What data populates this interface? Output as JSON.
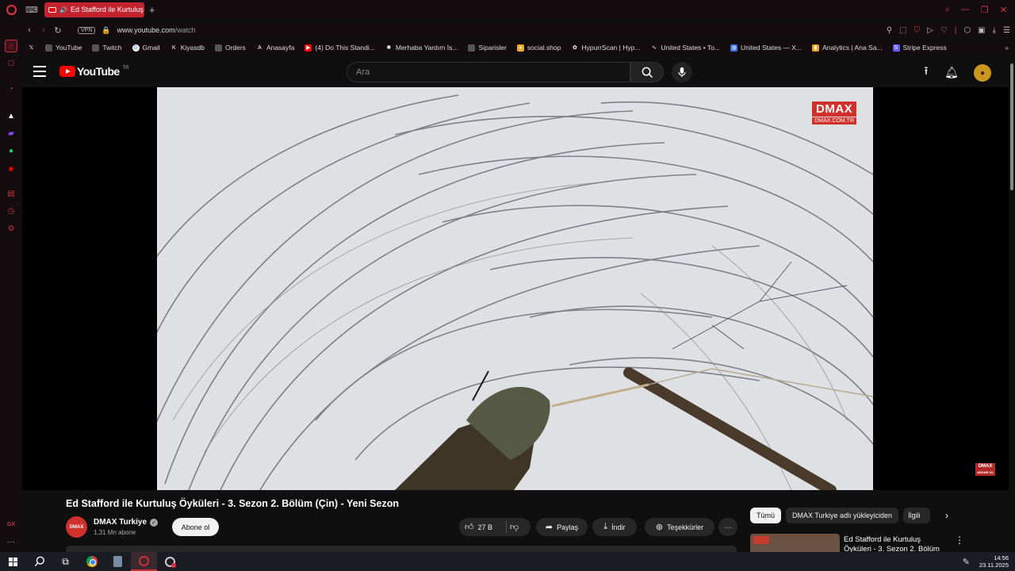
{
  "browser": {
    "tab_title": "Ed Stafford ile Kurtuluş",
    "url_domain": "www.youtube.com",
    "url_path": "/watch",
    "vpn_label": "VPN",
    "bookmarks": [
      {
        "label": "",
        "icon": "x-icon"
      },
      {
        "label": "YouTube",
        "icon": "page-icon"
      },
      {
        "label": "Twitch",
        "icon": "page-icon"
      },
      {
        "label": "Gmail",
        "icon": "google-icon"
      },
      {
        "label": "Kiyasdb",
        "icon": "k-icon"
      },
      {
        "label": "Orders",
        "icon": "page-icon"
      },
      {
        "label": "Anasayfa",
        "icon": "a-icon"
      },
      {
        "label": "(4) Do This Standi...",
        "icon": "youtube-icon"
      },
      {
        "label": "Merhaba Yardım İs...",
        "icon": "openai-icon"
      },
      {
        "label": "Siparisler",
        "icon": "page-icon"
      },
      {
        "label": "social.shop",
        "icon": "social-icon"
      },
      {
        "label": "HypurrScan | Hyp...",
        "icon": "hypurr-icon"
      },
      {
        "label": "United States • To...",
        "icon": "chart-icon"
      },
      {
        "label": "United States — X...",
        "icon": "globe-icon"
      },
      {
        "label": "Analytics | Ana Sa...",
        "icon": "analytics-icon"
      },
      {
        "label": "Stripe Express",
        "icon": "stripe-icon"
      }
    ]
  },
  "youtube": {
    "logo_text": "YouTube",
    "logo_region": "TR",
    "search_placeholder": "Ara",
    "video": {
      "watermark": "DMAX",
      "watermark_sub": "DMAX.COM.TR",
      "corner_logo": "DMAX",
      "corner_sub": "ABONE OL",
      "title": "Ed Stafford ile Kurtuluş Öyküleri - 3. Sezon 2. Bölüm (Çin) - Yeni Sezon"
    },
    "channel": {
      "avatar_text": "DMAX",
      "name": "DMAX Turkiye",
      "subscribers": "1,31 Mn abone",
      "subscribe_label": "Abone ol"
    },
    "actions": {
      "likes": "27 B",
      "share": "Paylaş",
      "download": "İndir",
      "thanks": "Teşekkürler"
    },
    "chips": [
      "Tümü",
      "DMAX Turkiye adlı yükleyiciden",
      "İlgili"
    ],
    "recommendation": {
      "title": "Ed Stafford ile Kurtuluş Öyküleri - 3. Sezon 2. Bölüm"
    }
  },
  "taskbar": {
    "time": "14:56",
    "date": "23.11.2025"
  },
  "colors": {
    "opera_red": "#c8323c",
    "youtube_red": "#ff0000",
    "dmax_red": "#d0312d",
    "page_bg": "#0f0f0f"
  }
}
